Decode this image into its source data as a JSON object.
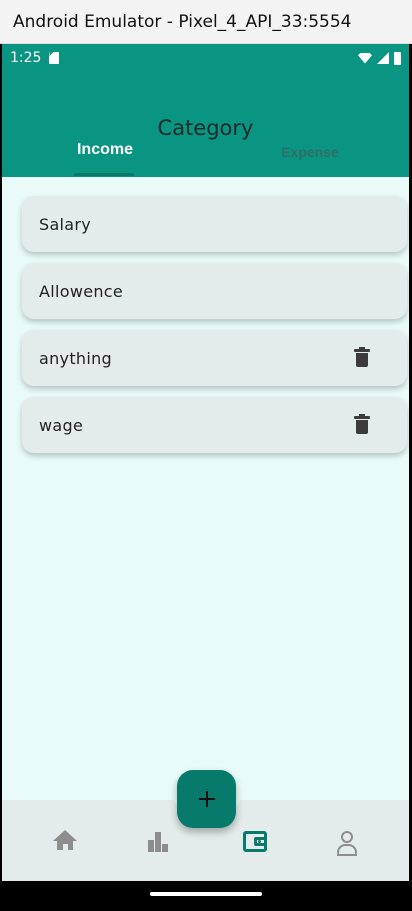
{
  "window": {
    "title": "Android Emulator - Pixel_4_API_33:5554"
  },
  "status_bar": {
    "time": "1:25",
    "icons": [
      "sd-card-icon",
      "wifi-icon",
      "signal-icon",
      "battery-icon"
    ]
  },
  "app_bar": {
    "title": "Category"
  },
  "tabs": [
    {
      "label": "Income",
      "selected": true
    },
    {
      "label": "Expense",
      "selected": false
    }
  ],
  "categories": [
    {
      "name": "Salary",
      "deletable": false
    },
    {
      "name": "Allowence",
      "deletable": false
    },
    {
      "name": "anything",
      "deletable": true
    },
    {
      "name": "wage",
      "deletable": true
    }
  ],
  "fab": {
    "icon": "plus-icon"
  },
  "bottom_nav": {
    "items": [
      {
        "icon": "home-icon",
        "active": false
      },
      {
        "icon": "bar-chart-icon",
        "active": false
      },
      {
        "icon": "wallet-icon",
        "active": true
      },
      {
        "icon": "person-icon",
        "active": false
      }
    ]
  },
  "colors": {
    "primary": "#0a9583",
    "accent": "#077a6b",
    "background": "#e8fbf8",
    "card": "#e3ecea"
  }
}
